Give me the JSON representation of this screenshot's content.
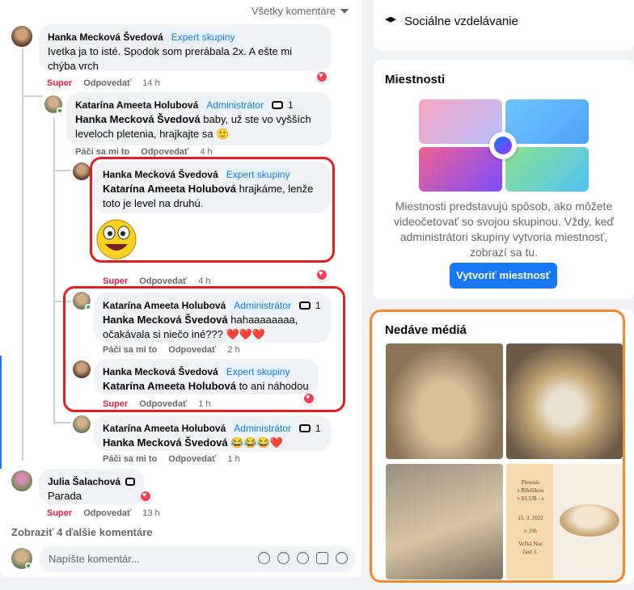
{
  "feed": {
    "sort_label": "Všetky komentáre",
    "comments": [
      {
        "author": "Hanka Mecková Švedová",
        "badge": "Expert skupiny",
        "text": "Ivetka ja to isté. Spodok som prerábala 2x. A ešte mi chýba vrch",
        "actions": [
          "Super",
          "Odpovedať"
        ],
        "time": "14 h"
      },
      {
        "author": "Katarína Ameeta Holubová",
        "badge": "Administrátor",
        "count": "1",
        "mention": "Hanka Mecková Švedová",
        "text": " baby, už ste vo vyšších leveloch pletenia, hrajkajte sa 🙂",
        "actions": [
          "Páči sa mi to",
          "Odpovedať"
        ],
        "time": "4 h"
      },
      {
        "author": "Hanka Mecková Švedová",
        "badge": "Expert skupiny",
        "mention": "Katarína Ameeta Holubová",
        "text": " hrajkáme, lenže toto je level na druhú.",
        "actions": [
          "Super",
          "Odpovedať"
        ],
        "time": "4 h"
      },
      {
        "author": "Katarína Ameeta Holubová",
        "badge": "Administrátor",
        "count": "1",
        "mention": "Hanka Mecková Švedová",
        "text": " hahaaaaaaaa, očakávala si niečo iné??? ❤️❤️❤️",
        "actions": [
          "Páči sa mi to",
          "Odpovedať"
        ],
        "time": "2 h"
      },
      {
        "author": "Hanka Mecková Švedová",
        "badge": "Expert skupiny",
        "mention": "Katarína Ameeta Holubová",
        "text": " to ani náhodou",
        "actions": [
          "Super",
          "Odpovedať"
        ],
        "time": "1 h"
      },
      {
        "author": "Katarína Ameeta Holubová",
        "badge": "Administrátor",
        "count": "1",
        "mention": "Hanka Mecková Švedová",
        "text": " 😂😂😂❤️",
        "actions": [
          "Páči sa mi to",
          "Odpovedať"
        ],
        "time": "1 h"
      },
      {
        "author": "Julia Šalachová",
        "text": "Parada",
        "actions": [
          "Super",
          "Odpovedať"
        ],
        "time": "13 h"
      }
    ],
    "more_comments": "Zobraziť 4 ďalšie komentáre",
    "compose_placeholder": "Napíšte komentár..."
  },
  "sidebar": {
    "topic_label": "Sociálne vzdelávanie",
    "rooms": {
      "title": "Miestnosti",
      "description": "Miestnosti predstavujú spôsob, ako môžete videočetovať so svojou skupinou. Vždy, keď administrátori skupiny vytvoria miestnosť, zobrazí sa tu.",
      "button": "Vytvoriť miestnosť"
    },
    "media": {
      "title": "Nedáve médiá",
      "poster_lines": [
        "Pletenie",
        "s Ribišškou",
        "v KLUB - e",
        "15. 3. 2022",
        "o 19h",
        "Veľká Noc",
        "časť 1."
      ]
    }
  },
  "colors": {
    "accent": "#1877f2",
    "super": "#e41e3f",
    "highlight_red": "#e02020",
    "highlight_orange": "#f5892a"
  }
}
